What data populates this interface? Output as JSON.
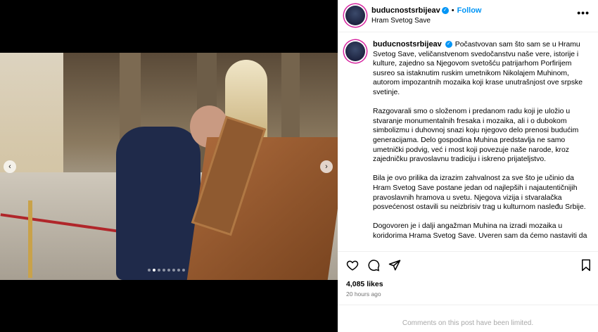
{
  "post": {
    "username": "buducnostsrbijeav",
    "follow_label": "Follow",
    "separator": "•",
    "location": "Hram Svetog Save",
    "more_glyph": "•••",
    "caption_paragraphs": [
      "Počastvovan sam što sam se u Hramu Svetog Save, veličanstvenom svedočanstvu naše vere, istorije i kulture, zajedno sa Njegovom svetošću patrijarhom Porfirijem susreo sa istaknutim ruskim umetnikom Nikolajem Muhinom, autorom impozantnih mozaika koji krase unutrašnjost ove srpske svetinje.",
      "Razgovarali smo o složenom i predanom radu koji je uložio u stvaranje monumentalnih fresaka i mozaika, ali i o dubokom simbolizmu i duhovnoj snazi koju njegovo delo prenosi budućim generacijama. Delo gospodina Muhina predstavlja ne samo umetnički podvig, već i most koji povezuje naše narode, kroz zajedničku pravoslavnu tradiciju i iskreno prijateljstvo.",
      "Bila je ovo prilika da izrazim zahvalnost za sve što je učinio da Hram Svetog Save postane jedan od najlepših i najautentičnijih pravoslavnih hramova u svetu. Njegova vizija i stvaralačka posvećenost ostavili su neizbrisiv trag u kulturnom nasleđu Srbije.",
      "Dogovoren je i dalji angažman Muhina na izradi mozaika u koridorima Hrama Svetog Save. Uveren sam da ćemo nastaviti da"
    ],
    "likes": "4,085 likes",
    "time": "20 hours ago",
    "comments_limited": "Comments on this post have been limited."
  },
  "carousel": {
    "prev_glyph": "‹",
    "next_glyph": "›",
    "dot_count": 8,
    "active_dot": 1
  },
  "icons": {
    "like": "heart-icon",
    "comment": "comment-icon",
    "share": "send-icon",
    "save": "bookmark-icon",
    "verified": "verified-badge-icon"
  },
  "colors": {
    "accent": "#0095f6",
    "muted": "#737373",
    "limited": "#a8a8a8"
  }
}
